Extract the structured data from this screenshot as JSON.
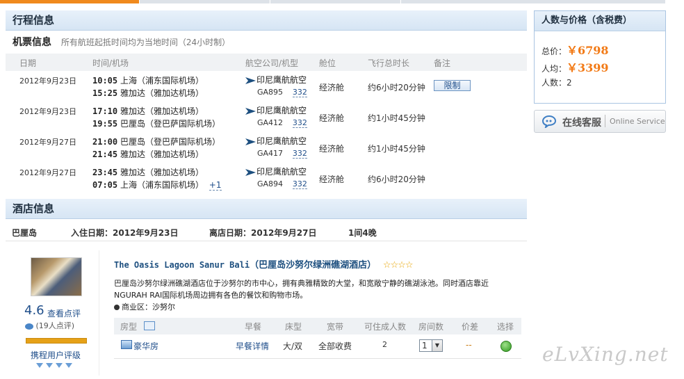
{
  "itinerary": {
    "section_title": "行程信息",
    "ticket_title": "机票信息",
    "ticket_note": "所有航班起抵时间均为当地时间（24小时制）",
    "columns": [
      "日期",
      "时间/机场",
      "航空公司/机型",
      "舱位",
      "飞行总时长",
      "备注"
    ],
    "flights": [
      {
        "date": "2012年9月23日",
        "dep_time": "10:05",
        "dep_airport": "上海（浦东国际机场）",
        "arr_time": "15:25",
        "arr_airport": "雅加达（雅加达机场）",
        "airline": "印尼鹰航航空",
        "flight_no": "GA895",
        "plane": "332",
        "cabin": "经济舱",
        "duration": "约6小时20分钟",
        "remark": "限制",
        "plus": ""
      },
      {
        "date": "2012年9月23日",
        "dep_time": "17:10",
        "dep_airport": "雅加达（雅加达机场）",
        "arr_time": "19:55",
        "arr_airport": "巴厘岛（登巴萨国际机场）",
        "airline": "印尼鹰航航空",
        "flight_no": "GA412",
        "plane": "332",
        "cabin": "经济舱",
        "duration": "约1小时45分钟",
        "remark": "",
        "plus": ""
      },
      {
        "date": "2012年9月27日",
        "dep_time": "21:00",
        "dep_airport": "巴厘岛（登巴萨国际机场）",
        "arr_time": "21:45",
        "arr_airport": "雅加达（雅加达机场）",
        "airline": "印尼鹰航航空",
        "flight_no": "GA417",
        "plane": "332",
        "cabin": "经济舱",
        "duration": "约1小时45分钟",
        "remark": "",
        "plus": ""
      },
      {
        "date": "2012年9月27日",
        "dep_time": "23:45",
        "dep_airport": "雅加达（雅加达机场）",
        "arr_time": "07:05",
        "arr_airport": "上海（浦东国际机场）",
        "airline": "印尼鹰航航空",
        "flight_no": "GA894",
        "plane": "332",
        "cabin": "经济舱",
        "duration": "约6小时20分钟",
        "remark": "",
        "plus": "+1"
      }
    ]
  },
  "hotel_info": {
    "section_title": "酒店信息",
    "city": "巴厘岛",
    "checkin": "入住日期：2012年9月23日",
    "checkout": "离店日期：2012年9月27日",
    "rooms_nights": "1间4晚",
    "score": "4.6",
    "reviews_link": "查看点评",
    "reviews_count": "(19人点评)",
    "rating_caption": "携程用户评级",
    "name_en": "The Oasis Lagoon Sanur Bali",
    "name_cn": "（巴厘岛沙努尔绿洲礁湖酒店）",
    "stars": "☆☆☆☆",
    "description": "巴厘岛沙努尔绿洲礁湖酒店位于沙努尔的市中心，拥有典雅精致的大堂，和宽敞宁静的礁湖泳池。同时酒店靠近NGURAH RAI国际机场周边拥有各色的餐饮和购物市场。",
    "district": "商业区：沙努尔",
    "room_columns": [
      "房型",
      "早餐",
      "床型",
      "宽带",
      "可住成人数",
      "房间数",
      "价差",
      "选择"
    ],
    "room": {
      "name": "豪华房",
      "breakfast": "早餐详情",
      "bed": "大/双",
      "broadband": "全部收费",
      "adults": "2",
      "rooms": "1",
      "diff": "--"
    }
  },
  "price_panel": {
    "title": "人数与价格（含税费）",
    "total_label": "总价：",
    "total": "￥6798",
    "per_label": "人均：",
    "per": "￥3399",
    "people_label": "人数：",
    "people": "2"
  },
  "service": {
    "cn": "在线客服",
    "en": "Online Service"
  },
  "watermark": "eLvXing.net",
  "colors": {
    "accent": "#f27a16",
    "link": "#1f4e8a",
    "header_bg": "#d6e5f4"
  }
}
